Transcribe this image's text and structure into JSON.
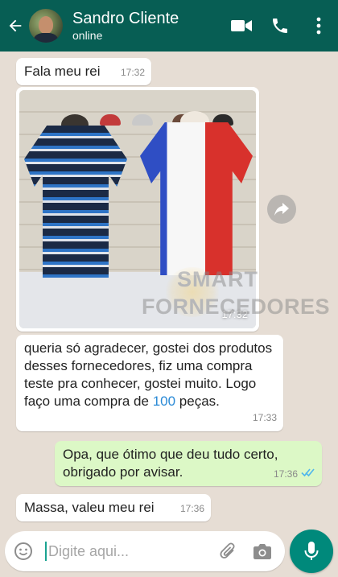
{
  "header": {
    "contact_name": "Sandro Cliente",
    "status": "online"
  },
  "icons": {
    "back": "back-arrow-icon",
    "video": "video-call-icon",
    "phone": "phone-call-icon",
    "menu": "more-vert-icon",
    "forward": "forward-icon",
    "emoji": "emoji-icon",
    "attach": "attach-icon",
    "camera": "camera-icon",
    "mic": "mic-icon"
  },
  "colors": {
    "header": "#075e54",
    "outgoing_bubble": "#dcf8c6",
    "read_ticks": "#4fb6ec",
    "mic_button": "#00897b",
    "highlight_number": "#2a8ad6"
  },
  "messages": [
    {
      "direction": "incoming",
      "text": "Fala meu rei",
      "time": "17:32"
    },
    {
      "direction": "incoming",
      "type": "image",
      "time": "17:32",
      "watermark": {
        "line1": "SMART",
        "line2": "FORNECEDORES"
      }
    },
    {
      "direction": "incoming",
      "text_before": "queria só agradecer, gostei dos produtos desses fornecedores, fiz uma compra teste pra conhecer, gostei muito. Logo faço uma compra de ",
      "highlight": "100",
      "text_after": " peças.",
      "time": "17:33"
    },
    {
      "direction": "outgoing",
      "text": "Opa, que ótimo que deu tudo certo, obrigado por avisar.",
      "time": "17:36",
      "status": "read"
    },
    {
      "direction": "incoming",
      "text": "Massa, valeu meu rei",
      "time": "17:36"
    }
  ],
  "composer": {
    "placeholder": "Digite aqui..."
  }
}
